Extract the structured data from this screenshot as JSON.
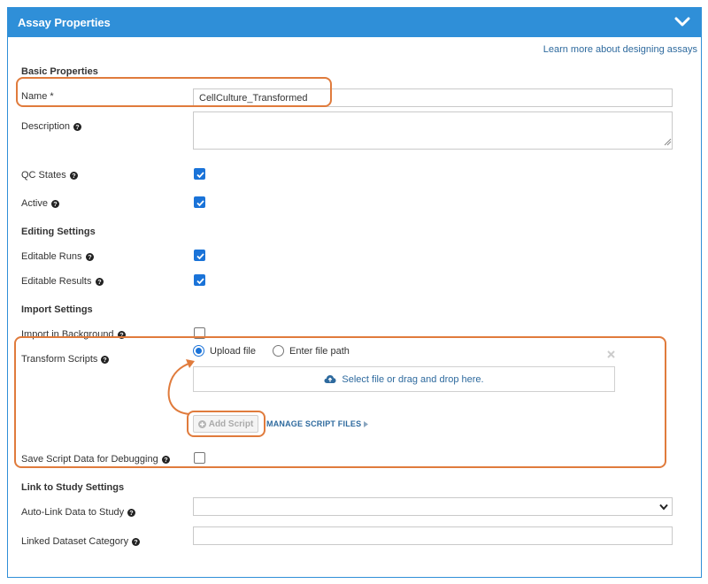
{
  "panel": {
    "title": "Assay Properties",
    "learn_more": "Learn more about designing assays"
  },
  "sections": {
    "basic": "Basic Properties",
    "editing": "Editing Settings",
    "import": "Import Settings",
    "link": "Link to Study Settings"
  },
  "fields": {
    "name_label": "Name *",
    "name_value": "CellCulture_Transformed",
    "description_label": "Description",
    "description_value": "",
    "qc_states_label": "QC States",
    "qc_states_checked": true,
    "active_label": "Active",
    "active_checked": true,
    "editable_runs_label": "Editable Runs",
    "editable_runs_checked": true,
    "editable_results_label": "Editable Results",
    "editable_results_checked": true,
    "import_background_label": "Import in Background",
    "import_background_checked": false,
    "transform_scripts_label": "Transform Scripts",
    "upload_file_label": "Upload file",
    "enter_path_label": "Enter file path",
    "dropzone_text": "Select file or drag and drop here.",
    "add_script_label": "Add Script",
    "manage_scripts_label": "MANAGE SCRIPT FILES",
    "save_script_label": "Save Script Data for Debugging",
    "save_script_checked": false,
    "auto_link_label": "Auto-Link Data to Study",
    "auto_link_value": "",
    "linked_category_label": "Linked Dataset Category",
    "linked_category_value": ""
  },
  "colors": {
    "header": "#2f8fd8",
    "link": "#2e6a9e",
    "checkbox": "#1a73d8",
    "highlight": "#e07b3c"
  },
  "icons": [
    "chevron-down-icon",
    "help-icon",
    "check-icon",
    "close-icon",
    "cloud-upload-icon",
    "plus-circle-icon",
    "caret-right-icon",
    "dropdown-arrow-icon"
  ]
}
